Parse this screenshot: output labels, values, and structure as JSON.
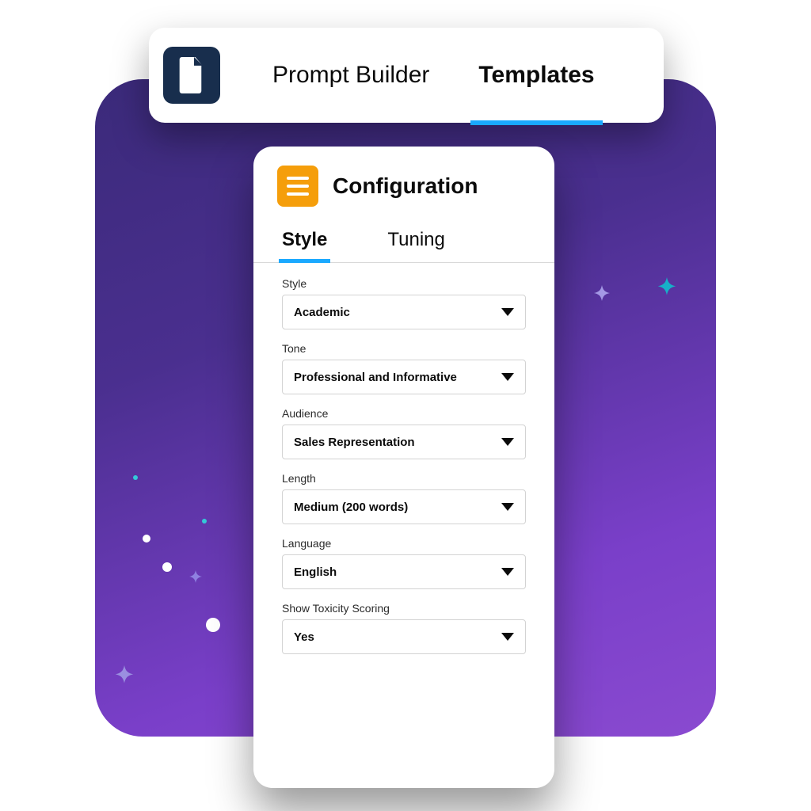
{
  "header": {
    "tabs": [
      {
        "label": "Prompt Builder",
        "active": false
      },
      {
        "label": "Templates",
        "active": true
      }
    ]
  },
  "panel": {
    "title": "Configuration",
    "tabs": [
      {
        "label": "Style",
        "active": true
      },
      {
        "label": "Tuning",
        "active": false
      }
    ],
    "fields": [
      {
        "label": "Style",
        "value": "Academic"
      },
      {
        "label": "Tone",
        "value": "Professional and Informative"
      },
      {
        "label": "Audience",
        "value": "Sales Representation"
      },
      {
        "label": "Length",
        "value": "Medium (200 words)"
      },
      {
        "label": "Language",
        "value": "English"
      },
      {
        "label": "Show Toxicity Scoring",
        "value": "Yes"
      }
    ]
  },
  "icons": {
    "doc": "document-icon",
    "menu": "menu-icon",
    "caret": "chevron-down-icon"
  }
}
